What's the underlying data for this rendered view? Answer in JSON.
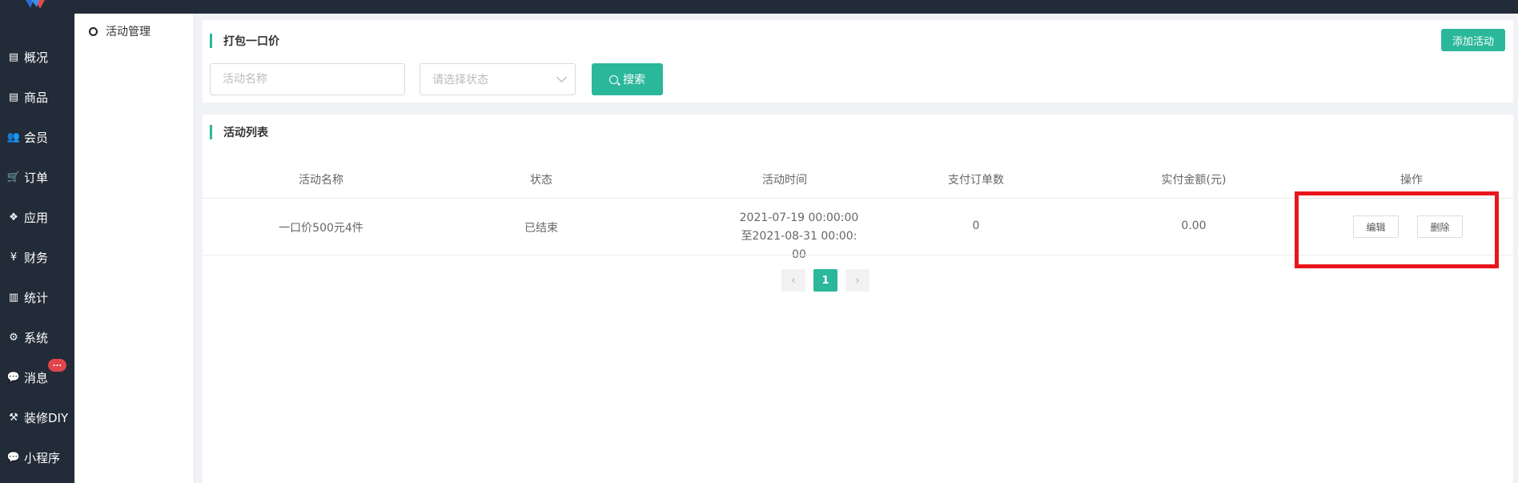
{
  "nav": {
    "items": [
      {
        "label": "概况",
        "icon": "archive-icon",
        "glyph": "▤"
      },
      {
        "label": "商品",
        "icon": "archive-icon",
        "glyph": "▤"
      },
      {
        "label": "会员",
        "icon": "users-icon",
        "glyph": "👥"
      },
      {
        "label": "订单",
        "icon": "cart-icon",
        "glyph": "🛒"
      },
      {
        "label": "应用",
        "icon": "cubes-icon",
        "glyph": "❖"
      },
      {
        "label": "财务",
        "icon": "yen-icon",
        "glyph": "¥"
      },
      {
        "label": "统计",
        "icon": "bar-chart-icon",
        "glyph": "▥"
      },
      {
        "label": "系统",
        "icon": "gears-icon",
        "glyph": "⚙"
      },
      {
        "label": "消息",
        "icon": "comment-icon",
        "glyph": "💬"
      },
      {
        "label": "装修DIY",
        "icon": "gavel-icon",
        "glyph": "⚒"
      },
      {
        "label": "小程序",
        "icon": "comments-icon",
        "glyph": "💬"
      }
    ],
    "message_badge": "..."
  },
  "submenu": {
    "item": "活动管理"
  },
  "filter": {
    "title": "打包一口价",
    "add_button": "添加活动",
    "name_placeholder": "活动名称",
    "status_placeholder": "请选择状态",
    "search_button": "搜索"
  },
  "list": {
    "title": "活动列表",
    "columns": [
      "活动名称",
      "状态",
      "活动时间",
      "支付订单数",
      "实付金额(元)",
      "操作"
    ],
    "rows": [
      {
        "name": "一口价500元4件",
        "status": "已结束",
        "time": "2021-07-19 00:00:00至2021-08-31 00:00:00",
        "orders": "0",
        "amount": "0.00",
        "edit": "编辑",
        "delete": "删除"
      }
    ]
  },
  "pagination": {
    "prev": "‹",
    "current": "1",
    "next": "›"
  },
  "colors": {
    "accent": "#2bb79a",
    "sidebar": "#222b38",
    "highlight": "#e8161c",
    "badge": "#e0454c"
  }
}
